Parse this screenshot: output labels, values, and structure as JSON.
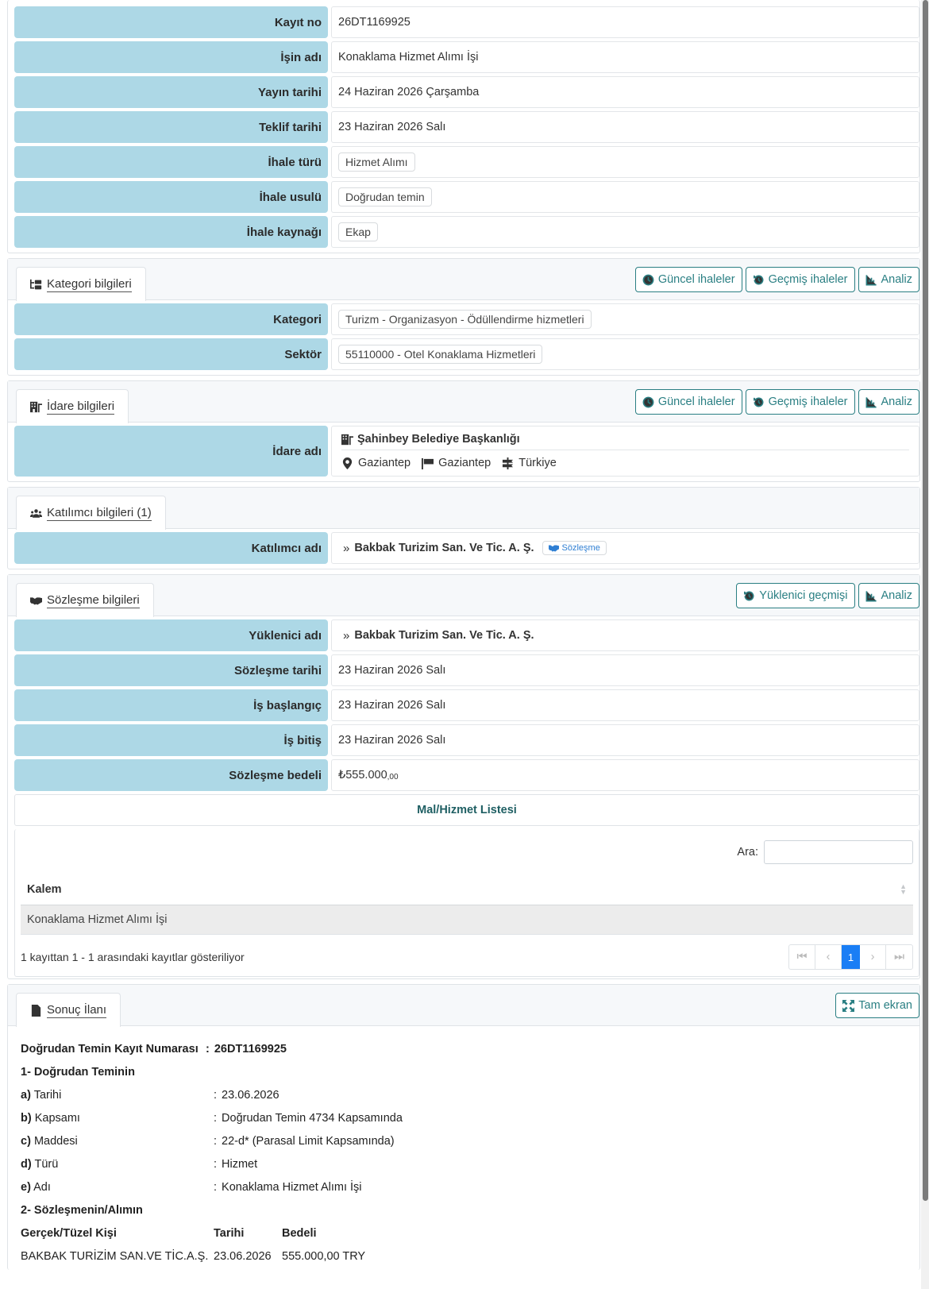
{
  "general": {
    "rows": [
      {
        "label": "Kayıt no",
        "value": "26DT1169925"
      },
      {
        "label": "İşin adı",
        "value": "Konaklama Hizmet Alımı İşi"
      },
      {
        "label": "Yayın tarihi",
        "value": "24 Haziran 2026 Çarşamba"
      },
      {
        "label": "Teklif tarihi",
        "value": "23 Haziran 2026 Salı"
      },
      {
        "label": "İhale türü",
        "value": "Hizmet Alımı"
      },
      {
        "label": "İhale usulü",
        "value": "Doğrudan temin"
      },
      {
        "label": "İhale kaynağı",
        "value": "Ekap"
      }
    ]
  },
  "kategori": {
    "tab": "Kategori bilgileri",
    "buttons": [
      "Güncel ihaleler",
      "Geçmiş ihaleler",
      "Analiz"
    ],
    "rows": [
      {
        "label": "Kategori",
        "value": "Turizm - Organizasyon - Ödüllendirme hizmetleri"
      },
      {
        "label": "Sektör",
        "value": "55110000 - Otel Konaklama Hizmetleri"
      }
    ]
  },
  "idare": {
    "tab": "İdare bilgileri",
    "buttons": [
      "Güncel ihaleler",
      "Geçmiş ihaleler",
      "Analiz"
    ],
    "label": "İdare adı",
    "name": "Şahinbey Belediye Başkanlığı",
    "city": "Gaziantep",
    "province": "Gaziantep",
    "country": "Türkiye"
  },
  "katilimci": {
    "tab": "Katılımcı bilgileri (1)",
    "label": "Katılımcı adı",
    "name": "Bakbak Turizim San. Ve Tic. A. Ş.",
    "badge": "Sözleşme"
  },
  "sozlesme": {
    "tab": "Sözleşme bilgileri",
    "buttons": [
      "Yüklenici geçmişi",
      "Analiz"
    ],
    "yuklenici_label": "Yüklenici adı",
    "yuklenici": "Bakbak Turizim San. Ve Tic. A. Ş.",
    "rows": [
      {
        "label": "Sözleşme tarihi",
        "value": "23 Haziran 2026 Salı"
      },
      {
        "label": "İş başlangıç",
        "value": "23 Haziran 2026 Salı"
      },
      {
        "label": "İş bitiş",
        "value": "23 Haziran 2026 Salı"
      }
    ],
    "bedel_label": "Sözleşme bedeli",
    "bedel_main": "₺555.000",
    "bedel_dec": ",00",
    "list_title": "Mal/Hizmet Listesi",
    "search_label": "Ara:",
    "column": "Kalem",
    "items": [
      "Konaklama Hizmet Alımı İşi"
    ],
    "info": "1 kayıttan 1 - 1 arasındaki kayıtlar gösteriliyor",
    "page": "1"
  },
  "sonuc": {
    "tab": "Sonuç İlanı",
    "fullscreen": "Tam ekran",
    "kayit_label": "Doğrudan Temin Kayıt Numarası",
    "kayit_value": "26DT1169925",
    "sec1": "1- Doğrudan Teminin",
    "items": [
      {
        "key": "a)",
        "label": "Tarihi",
        "value": "23.06.2026"
      },
      {
        "key": "b)",
        "label": "Kapsamı",
        "value": "Doğrudan Temin 4734 Kapsamında"
      },
      {
        "key": "c)",
        "label": "Maddesi",
        "value": "22-d* (Parasal Limit Kapsamında)"
      },
      {
        "key": "d)",
        "label": "Türü",
        "value": "Hizmet"
      },
      {
        "key": "e)",
        "label": "Adı",
        "value": "Konaklama Hizmet Alımı İşi"
      }
    ],
    "sec2": "2- Sözleşmenin/Alımın",
    "cols": [
      "Gerçek/Tüzel Kişi",
      "Tarihi",
      "Bedeli"
    ],
    "row": [
      "BAKBAK TURİZİM SAN.VE TİC.A.Ş.",
      "23.06.2026",
      "555.000,00 TRY"
    ]
  }
}
